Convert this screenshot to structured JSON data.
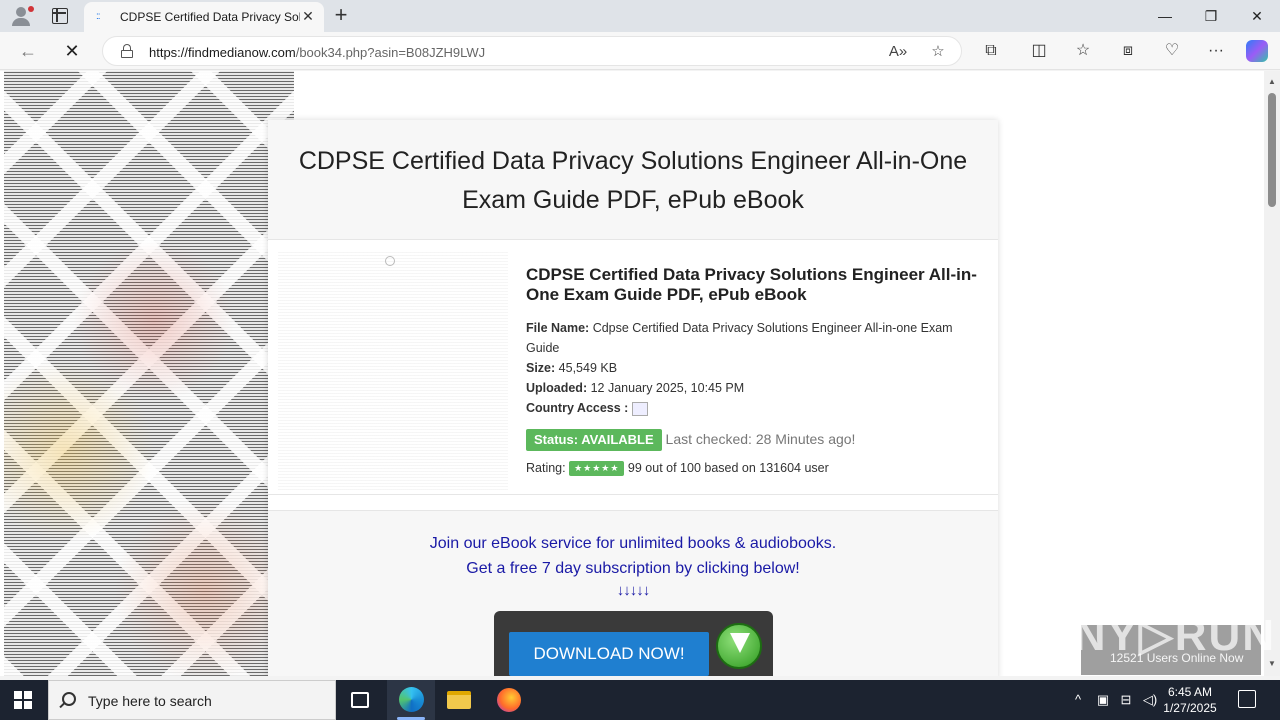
{
  "browser": {
    "tab_title": "CDPSE Certified Data Privacy Solu",
    "tab_favicon": "::",
    "tab_close": "✕",
    "new_tab": "+",
    "window": {
      "minimize": "—",
      "restore": "❐",
      "close": "✕"
    },
    "url_host": "https://findmedianow.com",
    "url_path": "/book34.php?asin=B08JZH9LWJ",
    "back": "←",
    "stop": "✕",
    "read_aloud": "A»",
    "favorite": "☆",
    "extensions": "⧉",
    "split": "◫",
    "favorites": "☆",
    "collections": "⧈",
    "performance": "♡",
    "more": "···"
  },
  "page": {
    "title": " CDPSE Certified Data Privacy Solutions Engineer All-in-One Exam Guide PDF, ePub eBook",
    "book_title": "CDPSE Certified Data Privacy Solutions Engineer All-in-One Exam Guide PDF, ePub eBook",
    "file_name_label": "File Name:",
    "file_name": "Cdpse Certified Data Privacy Solutions Engineer All-in-one Exam Guide",
    "size_label": "Size:",
    "size": "45,549 KB",
    "uploaded_label": "Uploaded:",
    "uploaded": "12 January 2025, 10:45 PM",
    "country_label": "Country Access :",
    "status_badge": "Status: AVAILABLE",
    "last_checked": "Last checked: 28 Minutes ago!",
    "rating_label": "Rating:",
    "stars": "★★★★★",
    "rating_text": "99 out of 100 based on 131604 user",
    "promo_line1": "Join our eBook service for unlimited books & audiobooks.",
    "promo_line2": "Get a free 7 day subscription by clicking below!",
    "arrows": "↓↓↓↓↓",
    "download_label": "DOWNLOAD NOW!"
  },
  "watermark": {
    "logo": "ANY▷RUN",
    "users_online": "12521 Users Online Now"
  },
  "taskbar": {
    "search_placeholder": "Type here to search",
    "time": "6:45 AM",
    "date": "1/27/2025",
    "tray_chevron": "^",
    "tray_network": "⊟",
    "tray_volume": "◁)"
  }
}
